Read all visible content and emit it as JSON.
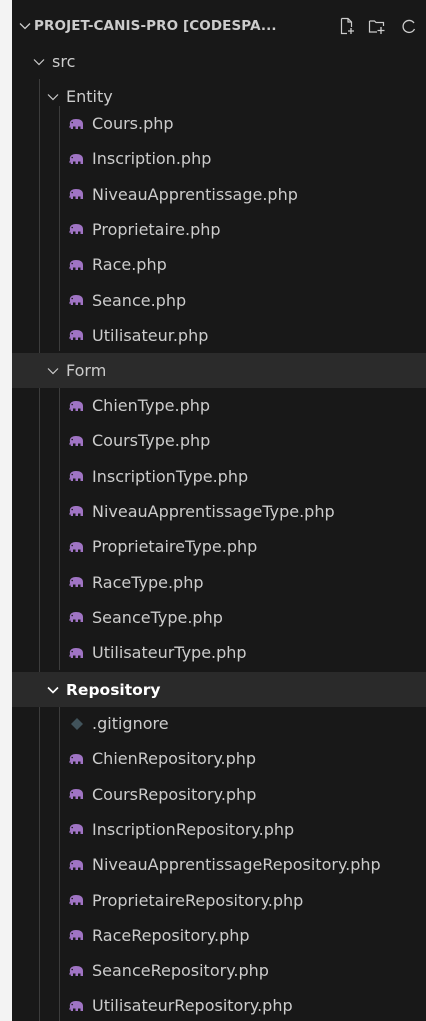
{
  "explorer": {
    "workspace_title": "PROJET-CANIS-PRO [CODESPA...",
    "actions": [
      "new-file-icon",
      "new-folder-icon",
      "refresh-icon"
    ],
    "colors": {
      "php_icon": "#a074c4",
      "gitignore_icon": "#41535b",
      "background": "#181818",
      "text": "#cccccc"
    },
    "src": {
      "label": "src",
      "entity": {
        "label": "Entity",
        "files": [
          "Cours.php",
          "Inscription.php",
          "NiveauApprentissage.php",
          "Proprietaire.php",
          "Race.php",
          "Seance.php",
          "Utilisateur.php"
        ]
      },
      "form": {
        "label": "Form",
        "files": [
          "ChienType.php",
          "CoursType.php",
          "InscriptionType.php",
          "NiveauApprentissageType.php",
          "ProprietaireType.php",
          "RaceType.php",
          "SeanceType.php",
          "UtilisateurType.php"
        ]
      },
      "repository": {
        "label": "Repository",
        "files": [
          ".gitignore",
          "ChienRepository.php",
          "CoursRepository.php",
          "InscriptionRepository.php",
          "NiveauApprentissageRepository.php",
          "ProprietaireRepository.php",
          "RaceRepository.php",
          "SeanceRepository.php",
          "UtilisateurRepository.php"
        ]
      }
    }
  }
}
